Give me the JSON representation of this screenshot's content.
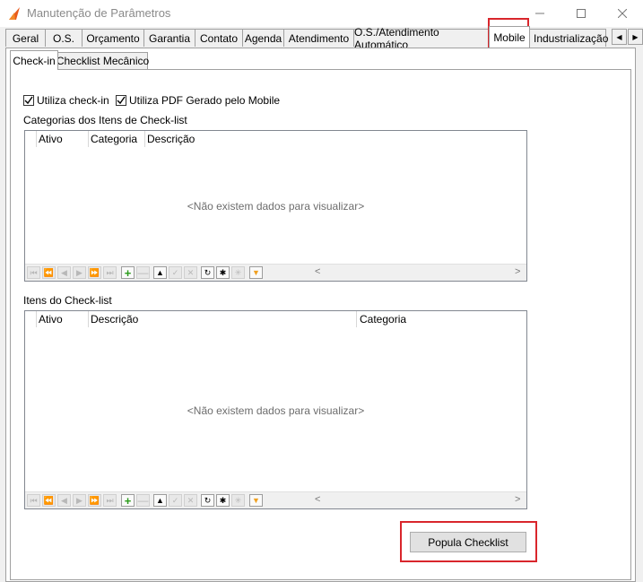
{
  "window": {
    "title": "Manutenção de Parâmetros"
  },
  "tabs": [
    "Geral",
    "O.S.",
    "Orçamento",
    "Garantia",
    "Contato",
    "Agenda",
    "Atendimento",
    "O.S./Atendimento Automático",
    "Mobile",
    "Industrialização"
  ],
  "active_tab": "Mobile",
  "subtabs": [
    "Check-in",
    "Checklist Mecânico"
  ],
  "active_subtab": "Check-in",
  "checkin": {
    "utiliza_checkin_label": "Utiliza check-in",
    "utiliza_checkin_checked": true,
    "utiliza_pdf_label": "Utiliza PDF Gerado pelo Mobile",
    "utiliza_pdf_checked": true,
    "categorias_label": "Categorias dos Itens de Check-list",
    "categorias_grid": {
      "columns": [
        "Ativo",
        "Categoria",
        "Descrição"
      ],
      "empty_text": "<Não existem dados para visualizar>"
    },
    "itens_label": "Itens do Check-list",
    "itens_grid": {
      "columns": [
        "Ativo",
        "Descrição",
        "Categoria"
      ],
      "empty_text": "<Não existem dados para visualizar>"
    },
    "popula_button": "Popula Checklist"
  },
  "nav_buttons": [
    "first",
    "prev-page",
    "prev",
    "next",
    "next-page",
    "last",
    "insert",
    "delete",
    "edit",
    "post",
    "cancel",
    "refresh",
    "bookmark",
    "goto-bookmark",
    "filter"
  ],
  "colors": {
    "highlight": "#d9262c",
    "insert": "#2a9b1a",
    "filter": "#f0a020"
  }
}
